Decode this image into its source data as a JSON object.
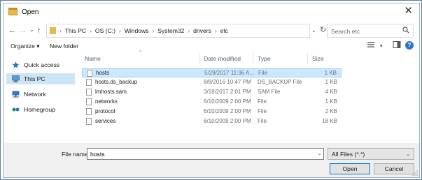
{
  "window": {
    "title": "Open",
    "close_glyph": "✕"
  },
  "nav_buttons": {
    "back": "←",
    "forward": "→",
    "dropdown": "⌄",
    "up": "↑"
  },
  "address": {
    "crumbs": [
      "This PC",
      "OS (C:)",
      "Windows",
      "System32",
      "drivers",
      "etc"
    ],
    "separator": "›",
    "dropdown_glyph": "⌄",
    "refresh_glyph": "↻"
  },
  "search": {
    "placeholder": "Search etc"
  },
  "toolbar": {
    "organize": "Organize ▾",
    "new_folder": "New folder",
    "view_dropdown": "▾",
    "help_glyph": "?"
  },
  "nav_pane": {
    "items": [
      {
        "label": "Quick access",
        "icon": "star-icon",
        "color": "#2b74c9"
      },
      {
        "label": "This PC",
        "icon": "computer-icon",
        "color": "#5b9bd5",
        "selected": true
      },
      {
        "label": "Network",
        "icon": "network-icon",
        "color": "#2b74c9"
      },
      {
        "label": "Homegroup",
        "icon": "homegroup-icon",
        "color": "#1e8f6a"
      }
    ]
  },
  "file_list": {
    "columns": {
      "name": "Name",
      "date": "Date modified",
      "type": "Type",
      "size": "Size"
    },
    "sort_indicator": "^",
    "rows": [
      {
        "name": "hosts",
        "date": "5/29/2017 11:36 A...",
        "type": "File",
        "size": "1 KB",
        "selected": true
      },
      {
        "name": "hosts.ds_backup",
        "date": "8/8/2016 10:47 PM",
        "type": "DS_BACKUP File",
        "size": "1 KB"
      },
      {
        "name": "lmhosts.sam",
        "date": "3/18/2017 2:01 PM",
        "type": "SAM File",
        "size": "4 KB"
      },
      {
        "name": "networks",
        "date": "6/10/2009 2:00 PM",
        "type": "File",
        "size": "1 KB"
      },
      {
        "name": "protocol",
        "date": "6/10/2009 2:00 PM",
        "type": "File",
        "size": "2 KB"
      },
      {
        "name": "services",
        "date": "6/10/2009 2:00 PM",
        "type": "File",
        "size": "18 KB"
      }
    ]
  },
  "bottom": {
    "file_name_label": "File name:",
    "file_name_value": "hosts",
    "file_type": "All Files (*.*)",
    "dropdown_glyph": "⌄",
    "open_label": "Open",
    "cancel_label": "Cancel"
  },
  "colors": {
    "selection": "#cce8ff",
    "selection_border": "#99d1ff",
    "accent": "#0078d7",
    "folder": "#e8b84a"
  }
}
